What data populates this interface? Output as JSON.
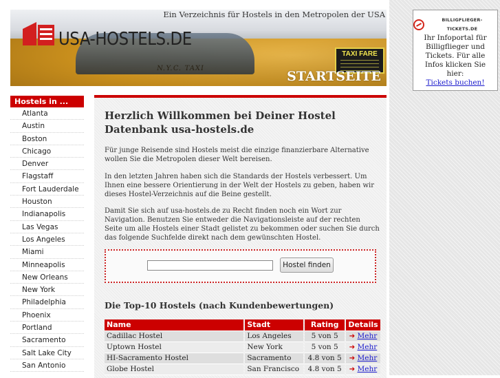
{
  "header": {
    "tagline": "Ein Verzeichnis für Hostels in den Metropolen der USA",
    "logo_text": "USA-HOSTELS.DE",
    "page_label": "STARTSEITE",
    "sign_text": "TAXI FARE",
    "car_text": "N.Y.C. TAXI"
  },
  "ad": {
    "logo_text": "BILLIGFLIEGER-TICKETS.DE",
    "text": "Ihr Infoportal für Billigflieger und Tickets. Für alle Infos klicken Sie hier:",
    "link": "Tickets buchen!"
  },
  "nav": {
    "title": "Hostels in ...",
    "items": [
      "Atlanta",
      "Austin",
      "Boston",
      "Chicago",
      "Denver",
      "Flagstaff",
      "Fort Lauderdale",
      "Houston",
      "Indianapolis",
      "Las Vegas",
      "Los Angeles",
      "Miami",
      "Minneapolis",
      "New Orleans",
      "New York",
      "Philadelphia",
      "Phoenix",
      "Portland",
      "Sacramento",
      "Salt Lake City",
      "San Antonio"
    ]
  },
  "main": {
    "heading": "Herzlich Willkommen bei Deiner Hostel Datenbank usa-hostels.de",
    "p1": "Für junge Reisende sind Hostels meist die einzige finanzierbare Alternative wollen Sie die Metropolen dieser Welt bereisen.",
    "p2": "In den letzten Jahren haben sich die Standards der Hostels verbessert. Um Ihnen eine bessere Orientierung in der Welt der Hostels zu geben, haben wir dieses Hostel-Verzeichnis auf die Beine gestellt.",
    "p3": "Damit Sie sich auf usa-hostels.de zu Recht finden noch ein Wort zur Navigation. Benutzen Sie entweder die Navigationsleiste auf der rechten Seite um alle Hostels einer Stadt gelistet zu bekommen oder suchen Sie durch das folgende Suchfelde direkt nach dem gewünschten Hostel.",
    "search_value": "",
    "search_button": "Hostel finden",
    "top_title": "Die Top-10 Hostels (nach Kundenbewertungen)",
    "table": {
      "headers": [
        "Name",
        "Stadt",
        "Rating",
        "Details"
      ],
      "rows": [
        {
          "name": "Cadillac Hostel",
          "city": "Los Angeles",
          "rating": "5 von 5",
          "details": "Mehr"
        },
        {
          "name": "Uptown Hostel",
          "city": "New York",
          "rating": "5 von 5",
          "details": "Mehr"
        },
        {
          "name": "HI-Sacramento Hostel",
          "city": "Sacramento",
          "rating": "4.8 von 5",
          "details": "Mehr"
        },
        {
          "name": "Globe Hostel",
          "city": "San Francisco",
          "rating": "4.8 von 5",
          "details": "Mehr"
        }
      ]
    }
  },
  "colors": {
    "accent": "#cc0000",
    "link": "#1a1acc"
  }
}
